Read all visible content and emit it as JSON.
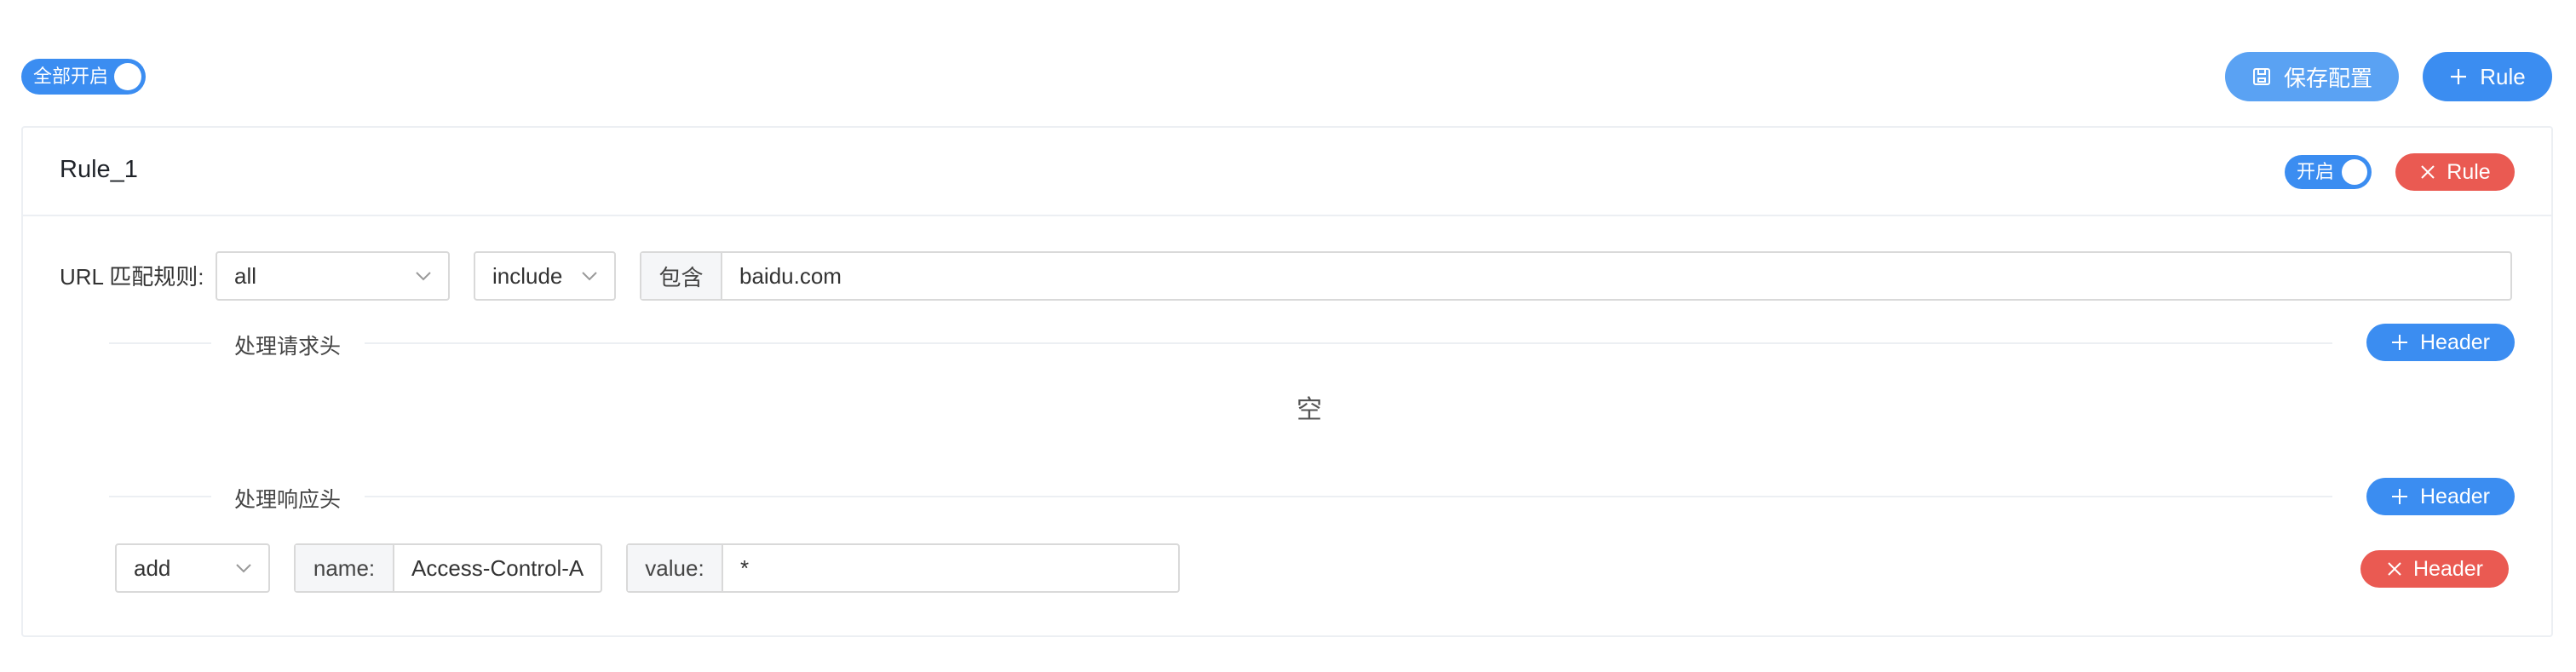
{
  "toolbar": {
    "all_toggle_label": "全部开启",
    "all_toggle_on": true,
    "save_label": "保存配置",
    "add_rule_label": "Rule"
  },
  "rule": {
    "title": "Rule_1",
    "toggle_label": "开启",
    "toggle_on": true,
    "delete_label": "Rule",
    "url_match_label": "URL 匹配规则:",
    "scope_value": "all",
    "mode_value": "include",
    "pattern_addon": "包含",
    "pattern_value": "baidu.com"
  },
  "request_headers": {
    "title": "处理请求头",
    "add_label": "Header",
    "empty_text": "空"
  },
  "response_headers": {
    "title": "处理响应头",
    "add_label": "Header",
    "rows": [
      {
        "action": "add",
        "name_addon": "name:",
        "name_value": "Access-Control-A",
        "value_addon": "value:",
        "value_value": "*",
        "delete_label": "Header"
      }
    ]
  },
  "colors": {
    "primary": "#3b8df1",
    "primary_light": "#5aa2f3",
    "danger": "#ea5a52",
    "border": "#d9d9d9"
  }
}
